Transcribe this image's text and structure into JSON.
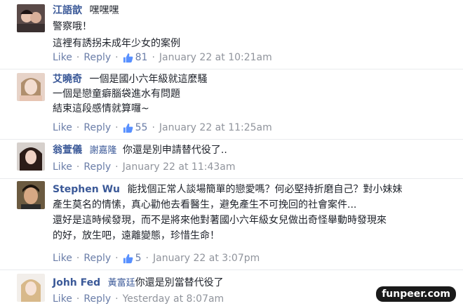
{
  "comments": [
    {
      "author": "江語歆",
      "tagged": "",
      "lines": [
        "嘿嘿嘿",
        "警察哦！",
        "這裡有誘拐未成年少女的案例"
      ],
      "like_label": "Like",
      "reply_label": "Reply",
      "like_count": "81",
      "timestamp": "January 22 at 10:21am",
      "avatar_icon": "avatar-photo"
    },
    {
      "author": "艾曉奇",
      "tagged": "",
      "lines": [
        "一個是國小六年級就這麼騷",
        "一個是戀童癖腦袋進水有問題",
        "結束這段感情就算囉~"
      ],
      "like_label": "Like",
      "reply_label": "Reply",
      "like_count": "55",
      "timestamp": "January 22 at 11:25am",
      "avatar_icon": "avatar-photo"
    },
    {
      "author": "翁萱儀",
      "tagged": "謝嘉隆",
      "lines": [
        "你還是別申請替代役了.."
      ],
      "like_label": "Like",
      "reply_label": "Reply",
      "like_count": "",
      "timestamp": "January 22 at 11:43am",
      "avatar_icon": "avatar-photo"
    },
    {
      "author": "Stephen Wu",
      "tagged": "",
      "lines": [
        "能找個正常人談場簡單的戀愛嗎？何必堅持折磨自己？對小妹妹",
        "產生莫名的情愫，真心勸他去看醫生，避免產生不可挽回的社會案件...",
        "",
        "還好是這時候發現，而不是將來他對著國小六年級女兒做出奇怪舉動時發現來",
        "的好，放生吧，遠離變態，珍惜生命！"
      ],
      "like_label": "Like",
      "reply_label": "Reply",
      "like_count": "5",
      "timestamp": "January 22 at 3:07pm",
      "avatar_icon": "avatar-photo"
    },
    {
      "author": "Johh Fed",
      "tagged": "黃富廷",
      "lines": [
        "你還是別當替代役了"
      ],
      "like_label": "Like",
      "reply_label": "Reply",
      "like_count": "",
      "timestamp": "Yesterday at 8:07am",
      "avatar_icon": "avatar-photo"
    }
  ],
  "watermark": "funpeer.com",
  "colors": {
    "link": "#3b5998",
    "timestamp": "#90949c",
    "action": "#6a7da8"
  }
}
